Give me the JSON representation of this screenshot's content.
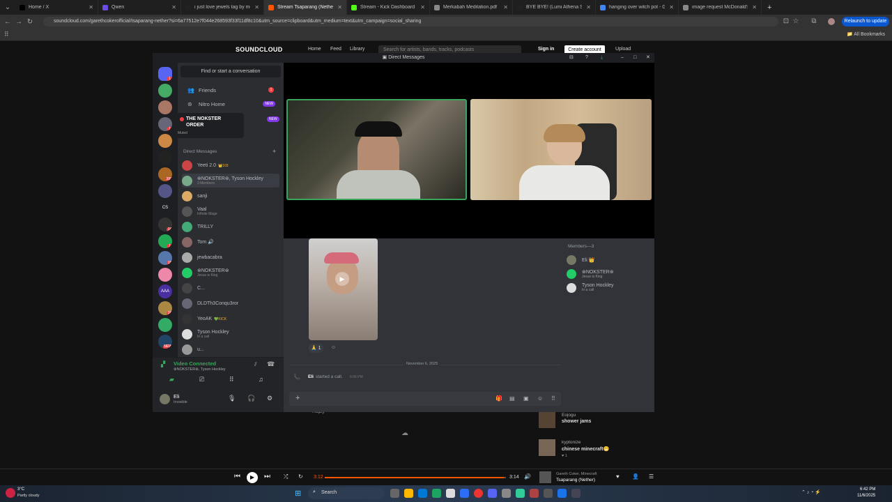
{
  "browser": {
    "tabs": [
      {
        "label": "Home / X",
        "color": "#000000",
        "active": false
      },
      {
        "label": "Qwen",
        "color": "#6b4de6",
        "active": false
      },
      {
        "label": "i just love jewels tag by money",
        "color": "#222222",
        "active": false
      },
      {
        "label": "Stream Tsaparang (Nether) by G",
        "color": "#ff5500",
        "active": true
      },
      {
        "label": "Stream - Kick Dashboard",
        "color": "#53fc18",
        "active": false
      },
      {
        "label": "Merkabah Meditation.pdf",
        "color": "#888888",
        "active": false
      },
      {
        "label": "BYE BYE! (Lumi Athena SFX) by",
        "color": "#222222",
        "active": false
      },
      {
        "label": "hanging over witch pot - Goog",
        "color": "#4285f4",
        "active": false
      },
      {
        "label": "image request McDonald's",
        "color": "#888888",
        "active": false
      }
    ],
    "new_tab": "+",
    "url": "soundcloud.com/garethcokerofficial/tsaparang-nether?si=6a77512e7f044e268593f33f11df8c10&utm_source=clipboard&utm_medium=text&utm_campaign=social_sharing",
    "relaunch": "Relaunch to update",
    "all_bookmarks": "All Bookmarks"
  },
  "soundcloud": {
    "logo": "SOUNDCLOUD",
    "nav": [
      "Home",
      "Feed",
      "Library"
    ],
    "search_placeholder": "Search for artists, bands, tracks, podcasts",
    "signin": "Sign in",
    "create": "Create account",
    "upload": "Upload",
    "reply": "Reply",
    "comments": [
      {
        "user": "Eojogu",
        "text": "shower jams"
      },
      {
        "user": "kyptonize",
        "text": "chinese minecraft😁",
        "likes": "1"
      }
    ]
  },
  "discord": {
    "title": "Direct Messages",
    "find": "Find or start a conversation",
    "nav": [
      {
        "label": "Friends",
        "icon": "friends-icon",
        "badge": "1"
      },
      {
        "label": "Nitro Home",
        "icon": "nitro-icon",
        "tag": "NEW"
      }
    ],
    "server_popup": {
      "name": "THE NOKSTER ORDER",
      "sub": "Muted",
      "tag": "NEW"
    },
    "dm_header": "Direct Messages",
    "dms": [
      {
        "name": "Yeeti 2.0",
        "tag": "👑103",
        "sub": ""
      },
      {
        "name": "⊛NOKSTER⊛, Tyson Hockley",
        "sub": "3 Members"
      },
      {
        "name": "sanji",
        "sub": ""
      },
      {
        "name": "Vaal",
        "sub": "Infinite Mage"
      },
      {
        "name": "TRILLY",
        "sub": ""
      },
      {
        "name": "Tom 🔊",
        "sub": ""
      },
      {
        "name": "jewbacabra",
        "sub": ""
      },
      {
        "name": "⊛NOKSTER⊛",
        "sub": "Jesus is King"
      },
      {
        "name": "C...",
        "sub": ""
      },
      {
        "name": "DLDTh3Conqu3ror",
        "sub": ""
      },
      {
        "name": "YeoAK",
        "tag": "💚KICK",
        "sub": ""
      },
      {
        "name": "Tyson Hockley",
        "sub": "In a call"
      },
      {
        "name": "u...",
        "sub": ""
      }
    ],
    "servers": [
      {
        "label": "",
        "badge": "1"
      },
      {
        "label": "",
        "badge": ""
      },
      {
        "label": "",
        "badge": ""
      },
      {
        "label": "",
        "badge": "1"
      },
      {
        "label": "",
        "badge": ""
      },
      {
        "label": "",
        "badge": ""
      },
      {
        "label": "",
        "badge": "395"
      },
      {
        "label": "",
        "badge": ""
      },
      {
        "label": "CS",
        "badge": ""
      },
      {
        "label": "",
        "badge": "14"
      },
      {
        "label": "",
        "badge": "1"
      },
      {
        "label": "",
        "badge": "15"
      },
      {
        "label": "",
        "badge": ""
      },
      {
        "label": "AAA",
        "badge": ""
      },
      {
        "label": "",
        "badge": "28"
      },
      {
        "label": "",
        "badge": ""
      },
      {
        "label": "",
        "badge": "NEW"
      }
    ],
    "voice": {
      "status": "Video Connected",
      "channel": "⊛NOKSTER⊛, Tyson Hockley"
    },
    "user": {
      "name": "Eli",
      "status": "Invisible"
    },
    "members_header": "Members—3",
    "members": [
      {
        "name": "Eli 👑",
        "sub": ""
      },
      {
        "name": "⊛NOKSTER⊛",
        "sub": "Jesus is King"
      },
      {
        "name": "Tyson Hockley",
        "sub": "In a call"
      }
    ],
    "reaction": {
      "emoji": "🙏",
      "count": "1"
    },
    "date_divider": "November 6, 2025",
    "call_msg": {
      "user": "Eli",
      "text": "started a call.",
      "time": "6:06 PM"
    }
  },
  "player": {
    "elapsed": "3:12",
    "duration": "3:14",
    "progress": 0.99,
    "artist": "Gareth Coker, Minecraft",
    "track": "Tsaparang (Nether)"
  },
  "taskbar": {
    "weather_temp": "3°C",
    "weather_desc": "Partly cloudy",
    "search": "Search",
    "time": "6:42 PM",
    "date": "11/6/2025"
  }
}
